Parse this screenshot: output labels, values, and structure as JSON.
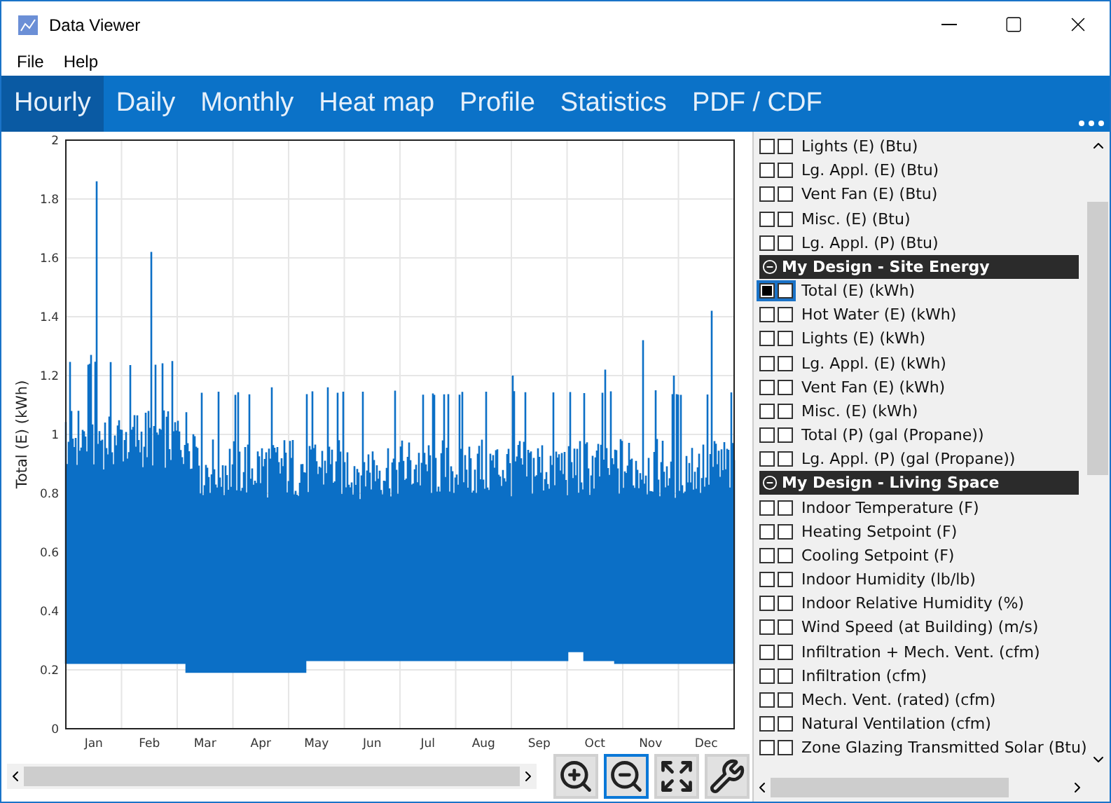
{
  "window": {
    "title": "Data Viewer"
  },
  "menu": [
    "File",
    "Help"
  ],
  "tabs": [
    {
      "label": "Hourly",
      "selected": true
    },
    {
      "label": "Daily",
      "selected": false
    },
    {
      "label": "Monthly",
      "selected": false
    },
    {
      "label": "Heat map",
      "selected": false
    },
    {
      "label": "Profile",
      "selected": false
    },
    {
      "label": "Statistics",
      "selected": false
    },
    {
      "label": "PDF / CDF",
      "selected": false
    }
  ],
  "chart": {
    "ylabel": "Total (E) (kWh)",
    "yticks": [
      "2",
      "1.8",
      "1.6",
      "1.4",
      "1.2",
      "1",
      "0.8",
      "0.6",
      "0.4",
      "0.2",
      "0"
    ],
    "months": [
      "Jan",
      "Feb",
      "Mar",
      "Apr",
      "May",
      "Jun",
      "Jul",
      "Aug",
      "Sep",
      "Oct",
      "Nov",
      "Dec"
    ]
  },
  "tools": [
    {
      "kind": "zoom_in",
      "selected": false
    },
    {
      "kind": "zoom_out",
      "selected": true
    },
    {
      "kind": "fit",
      "selected": false
    },
    {
      "kind": "settings",
      "selected": false
    }
  ],
  "series_list": [
    {
      "kind": "item",
      "label": "Lights (E) (Btu)",
      "checked_a": false,
      "checked_b": false,
      "focused": false
    },
    {
      "kind": "item",
      "label": "Lg. Appl. (E) (Btu)",
      "checked_a": false,
      "checked_b": false,
      "focused": false
    },
    {
      "kind": "item",
      "label": "Vent Fan (E) (Btu)",
      "checked_a": false,
      "checked_b": false,
      "focused": false
    },
    {
      "kind": "item",
      "label": "Misc. (E) (Btu)",
      "checked_a": false,
      "checked_b": false,
      "focused": false
    },
    {
      "kind": "item",
      "label": "Lg. Appl. (P) (Btu)",
      "checked_a": false,
      "checked_b": false,
      "focused": false
    },
    {
      "kind": "header",
      "label": "My Design - Site Energy",
      "expanded": true
    },
    {
      "kind": "item",
      "label": "Total (E) (kWh)",
      "checked_a": true,
      "checked_b": false,
      "focused": true
    },
    {
      "kind": "item",
      "label": "Hot Water (E) (kWh)",
      "checked_a": false,
      "checked_b": false,
      "focused": false
    },
    {
      "kind": "item",
      "label": "Lights (E) (kWh)",
      "checked_a": false,
      "checked_b": false,
      "focused": false
    },
    {
      "kind": "item",
      "label": "Lg. Appl. (E) (kWh)",
      "checked_a": false,
      "checked_b": false,
      "focused": false
    },
    {
      "kind": "item",
      "label": "Vent Fan (E) (kWh)",
      "checked_a": false,
      "checked_b": false,
      "focused": false
    },
    {
      "kind": "item",
      "label": "Misc. (E) (kWh)",
      "checked_a": false,
      "checked_b": false,
      "focused": false
    },
    {
      "kind": "item",
      "label": "Total (P) (gal (Propane))",
      "checked_a": false,
      "checked_b": false,
      "focused": false
    },
    {
      "kind": "item",
      "label": "Lg. Appl. (P) (gal (Propane))",
      "checked_a": false,
      "checked_b": false,
      "focused": false
    },
    {
      "kind": "header",
      "label": "My Design - Living Space",
      "expanded": true
    },
    {
      "kind": "item",
      "label": "Indoor Temperature (F)",
      "checked_a": false,
      "checked_b": false,
      "focused": false
    },
    {
      "kind": "item",
      "label": "Heating Setpoint (F)",
      "checked_a": false,
      "checked_b": false,
      "focused": false
    },
    {
      "kind": "item",
      "label": "Cooling Setpoint (F)",
      "checked_a": false,
      "checked_b": false,
      "focused": false
    },
    {
      "kind": "item",
      "label": "Indoor Humidity (lb/lb)",
      "checked_a": false,
      "checked_b": false,
      "focused": false
    },
    {
      "kind": "item",
      "label": "Indoor Relative Humidity (%)",
      "checked_a": false,
      "checked_b": false,
      "focused": false
    },
    {
      "kind": "item",
      "label": "Wind Speed (at Building) (m/s)",
      "checked_a": false,
      "checked_b": false,
      "focused": false
    },
    {
      "kind": "item",
      "label": "Infiltration + Mech. Vent. (cfm)",
      "checked_a": false,
      "checked_b": false,
      "focused": false
    },
    {
      "kind": "item",
      "label": "Infiltration (cfm)",
      "checked_a": false,
      "checked_b": false,
      "focused": false
    },
    {
      "kind": "item",
      "label": "Mech. Vent. (rated) (cfm)",
      "checked_a": false,
      "checked_b": false,
      "focused": false
    },
    {
      "kind": "item",
      "label": "Natural Ventilation (cfm)",
      "checked_a": false,
      "checked_b": false,
      "focused": false
    },
    {
      "kind": "item",
      "label": "Zone Glazing Transmitted Solar (Btu)",
      "checked_a": false,
      "checked_b": false,
      "focused": false
    }
  ]
}
